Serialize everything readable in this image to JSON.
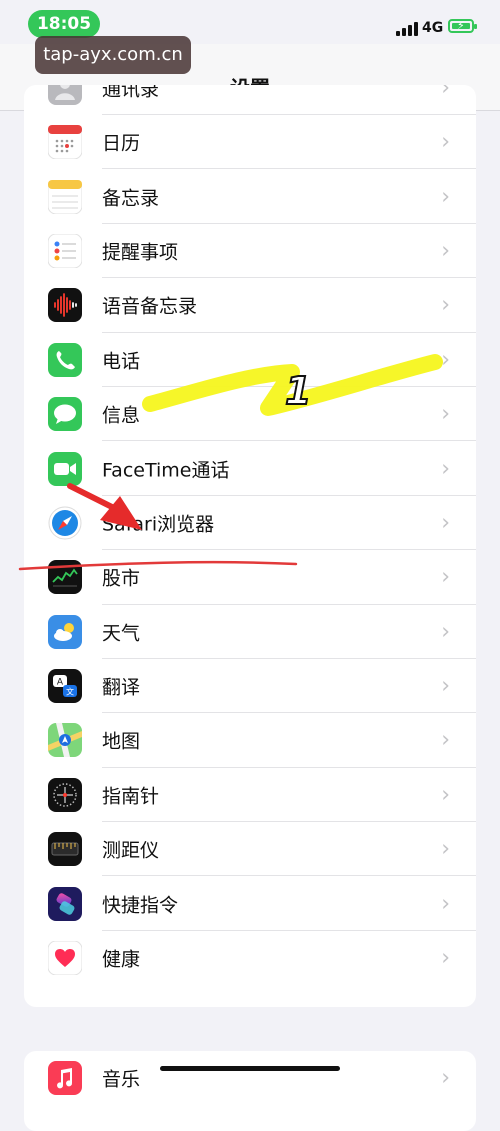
{
  "status_bar": {
    "time": "18:05",
    "network": "4G"
  },
  "watermark": "tap-ayx.com.cn",
  "nav": {
    "title": "设置"
  },
  "settings_items": [
    {
      "label": "通讯录",
      "icon": "contacts-icon",
      "color": "#b9b9bd"
    },
    {
      "label": "日历",
      "icon": "calendar-icon",
      "color": "#ffffff"
    },
    {
      "label": "备忘录",
      "icon": "notes-icon",
      "color": "#ffffff"
    },
    {
      "label": "提醒事项",
      "icon": "reminders-icon",
      "color": "#ffffff"
    },
    {
      "label": "语音备忘录",
      "icon": "voice-memos-icon",
      "color": "#111111"
    },
    {
      "label": "电话",
      "icon": "phone-icon",
      "color": "#34c759"
    },
    {
      "label": "信息",
      "icon": "messages-icon",
      "color": "#34c759"
    },
    {
      "label": "FaceTime通话",
      "icon": "facetime-icon",
      "color": "#34c759"
    },
    {
      "label": "Safari浏览器",
      "icon": "safari-icon",
      "color": "#1e88e5"
    },
    {
      "label": "股市",
      "icon": "stocks-icon",
      "color": "#111111"
    },
    {
      "label": "天气",
      "icon": "weather-icon",
      "color": "#3a8ee6"
    },
    {
      "label": "翻译",
      "icon": "translate-icon",
      "color": "#111111"
    },
    {
      "label": "地图",
      "icon": "maps-icon",
      "color": "#7ed67a"
    },
    {
      "label": "指南针",
      "icon": "compass-icon",
      "color": "#111111"
    },
    {
      "label": "测距仪",
      "icon": "measure-icon",
      "color": "#111111"
    },
    {
      "label": "快捷指令",
      "icon": "shortcuts-icon",
      "color": "#4b3bd1"
    },
    {
      "label": "健康",
      "icon": "health-icon",
      "color": "#ffffff"
    }
  ],
  "next_group_items": [
    {
      "label": "音乐",
      "icon": "music-icon",
      "color": "#fa3c55"
    }
  ],
  "annotation": {
    "number_label": "1"
  }
}
